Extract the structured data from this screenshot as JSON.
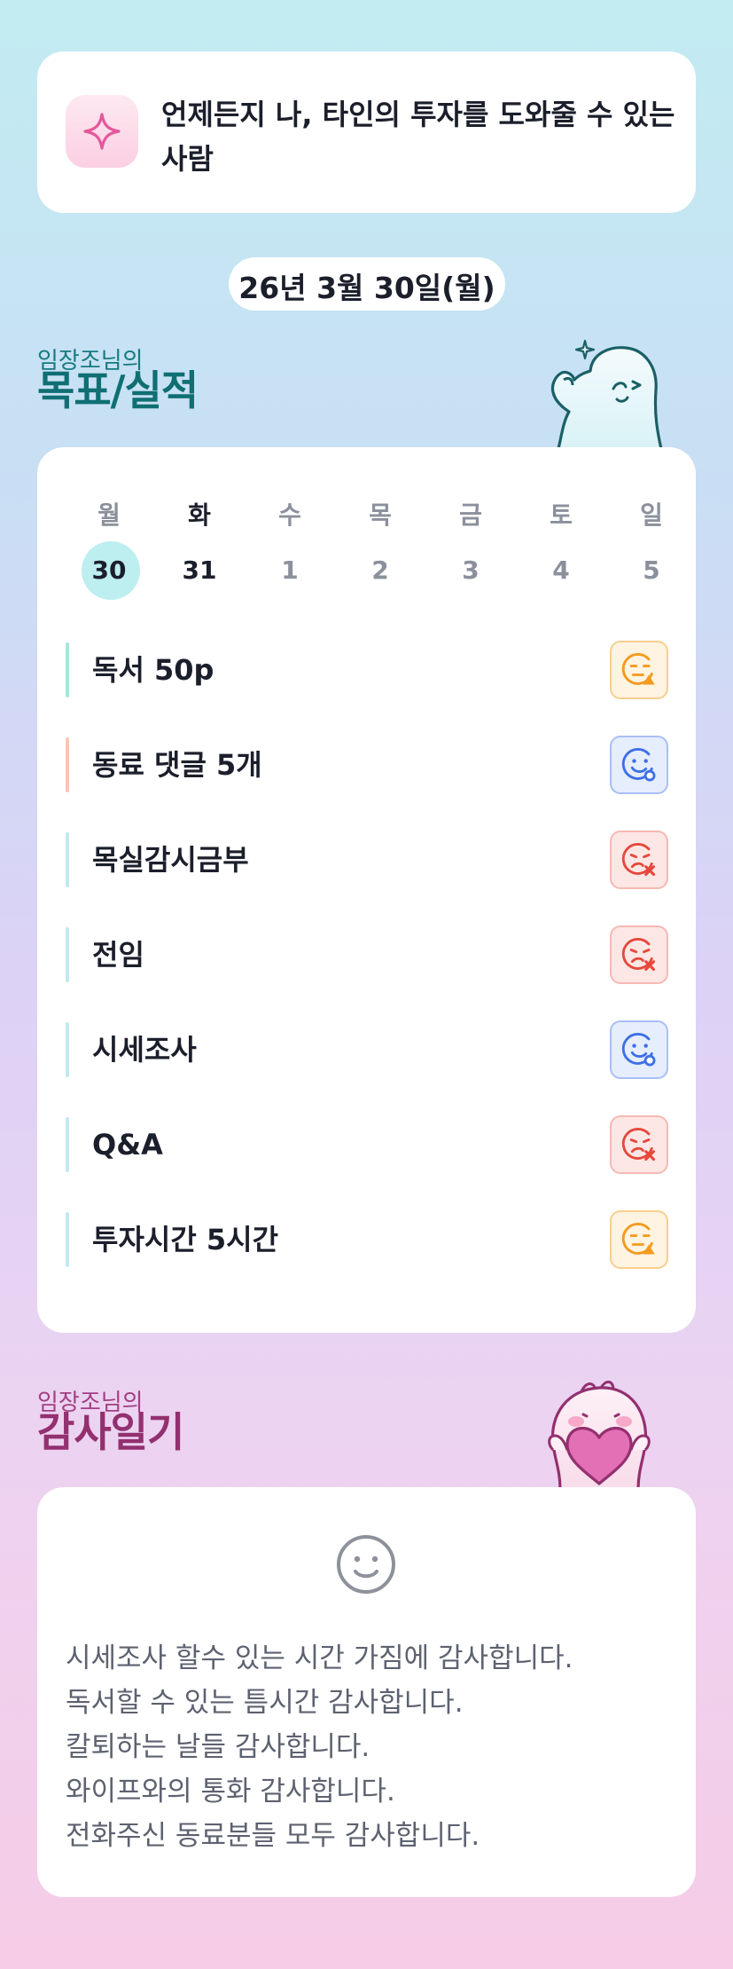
{
  "motto": {
    "text": "언제든지 나, 타인의 투자를 도와줄 수 있는 사람",
    "icon": "sparkle-icon"
  },
  "date_label": "26년 3월 30일(월)",
  "goals_section": {
    "subtitle": "임장조님의",
    "title": "목표/실적"
  },
  "week": {
    "days": [
      "월",
      "화",
      "수",
      "목",
      "금",
      "토",
      "일"
    ],
    "dates": [
      "30",
      "31",
      "1",
      "2",
      "3",
      "4",
      "5"
    ],
    "selected_index": 0
  },
  "goals": [
    {
      "label": "독서 50p",
      "status": "triangle",
      "accent": "#a6e6dc"
    },
    {
      "label": "동료 댓글 5개",
      "status": "circle",
      "accent": "#f7c7b4"
    },
    {
      "label": "목실감시금부",
      "status": "x",
      "accent": "#bfeaf0"
    },
    {
      "label": "전임",
      "status": "x",
      "accent": "#bfeaf0"
    },
    {
      "label": "시세조사",
      "status": "circle",
      "accent": "#bfeaf0"
    },
    {
      "label": "Q&A",
      "status": "x",
      "accent": "#bfeaf0"
    },
    {
      "label": "투자시간 5시간",
      "status": "triangle",
      "accent": "#bfeaf0"
    }
  ],
  "status_colors": {
    "triangle": "#f39a1e",
    "circle": "#3d6fe6",
    "x": "#e5483c"
  },
  "thanks_section": {
    "subtitle": "임장조님의",
    "title": "감사일기"
  },
  "thanks_lines": [
    "시세조사 할수 있는 시간 가짐에 감사합니다.",
    "독서할 수 있는 틈시간 감사합니다.",
    "칼퇴하는 날들 감사합니다.",
    "와이프와의 통화 감사합니다.",
    "전화주신 동료분들 모두 감사합니다."
  ]
}
